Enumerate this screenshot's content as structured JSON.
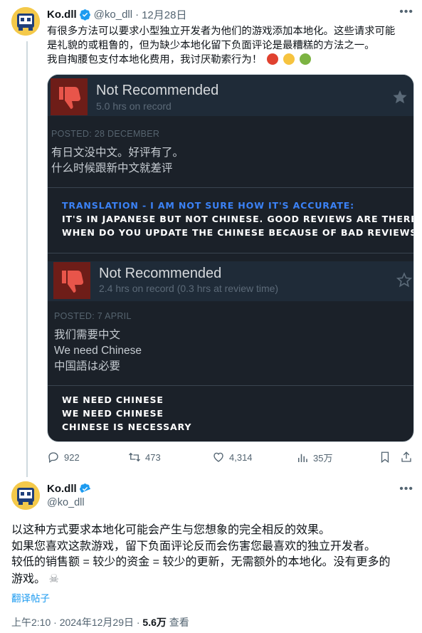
{
  "tweet1": {
    "name": "Ko.dll",
    "handle": "@ko_dll",
    "sep": "·",
    "date": "12月28日",
    "text_lines": [
      "有很多方法可以要求小型独立开发者为他们的游戏添加本地化。这些请求可能",
      "是礼貌的或粗鲁的，但为缺少本地化留下负面评论是最糟糕的方法之一。",
      "我自掏腰包支付本地化费用，我讨厌勒索行为！"
    ],
    "emojis": [
      "angry-face-icon",
      "pleading-face-icon",
      "nauseated-face-icon"
    ],
    "image": {
      "review1": {
        "title": "Not Recommended",
        "hours": "5.0 hrs on record",
        "posted": "POSTED: 28 DECEMBER",
        "body": [
          "有日文没中文。好评有了。",
          "什么时候跟新中文就差评"
        ],
        "translation_label": "TRANSLATION - I AM NOT SURE HOW IT'S ACCURATE:",
        "translation": [
          "IT'S IN JAPANESE BUT NOT CHINESE. GOOD REVIEWS ARE THERE.",
          "WHEN DO YOU UPDATE THE CHINESE BECAUSE OF BAD REVIEWS?"
        ]
      },
      "review2": {
        "title": "Not Recommended",
        "hours": "2.4 hrs on record (0.3 hrs at review time)",
        "posted": "POSTED: 7 APRIL",
        "body": [
          "我们需要中文",
          "We need Chinese",
          "中国語は必要"
        ],
        "translation": [
          "WE NEED CHINESE",
          "WE NEED CHINESE",
          "CHINESE IS NECESSARY"
        ]
      }
    },
    "actions": {
      "replies": "922",
      "retweets": "473",
      "likes": "4,314",
      "views": "35万"
    }
  },
  "tweet2": {
    "name": "Ko.dll",
    "handle": "@ko_dll",
    "text_lines": [
      "以这种方式要求本地化可能会产生与您想象的完全相反的效果。",
      "如果您喜欢这款游戏，留下负面评论反而会伤害您最喜欢的独立开发者。",
      "较低的销售额 = 较少的资金 = 较少的更新，无需额外的本地化。没有更多的",
      "游戏。"
    ],
    "emoji": "skull-crossbones-icon",
    "translate_link": "翻译帖子",
    "time": "上午2:10 · 2024年12月29日 · ",
    "views_count": "5.6万",
    "views_label": " 查看"
  },
  "colors": {
    "verified": "#1d9bf0",
    "steam_bg": "#1b2129",
    "thumb_red": "#a52a22",
    "translation_blue": "#3b82f6"
  }
}
